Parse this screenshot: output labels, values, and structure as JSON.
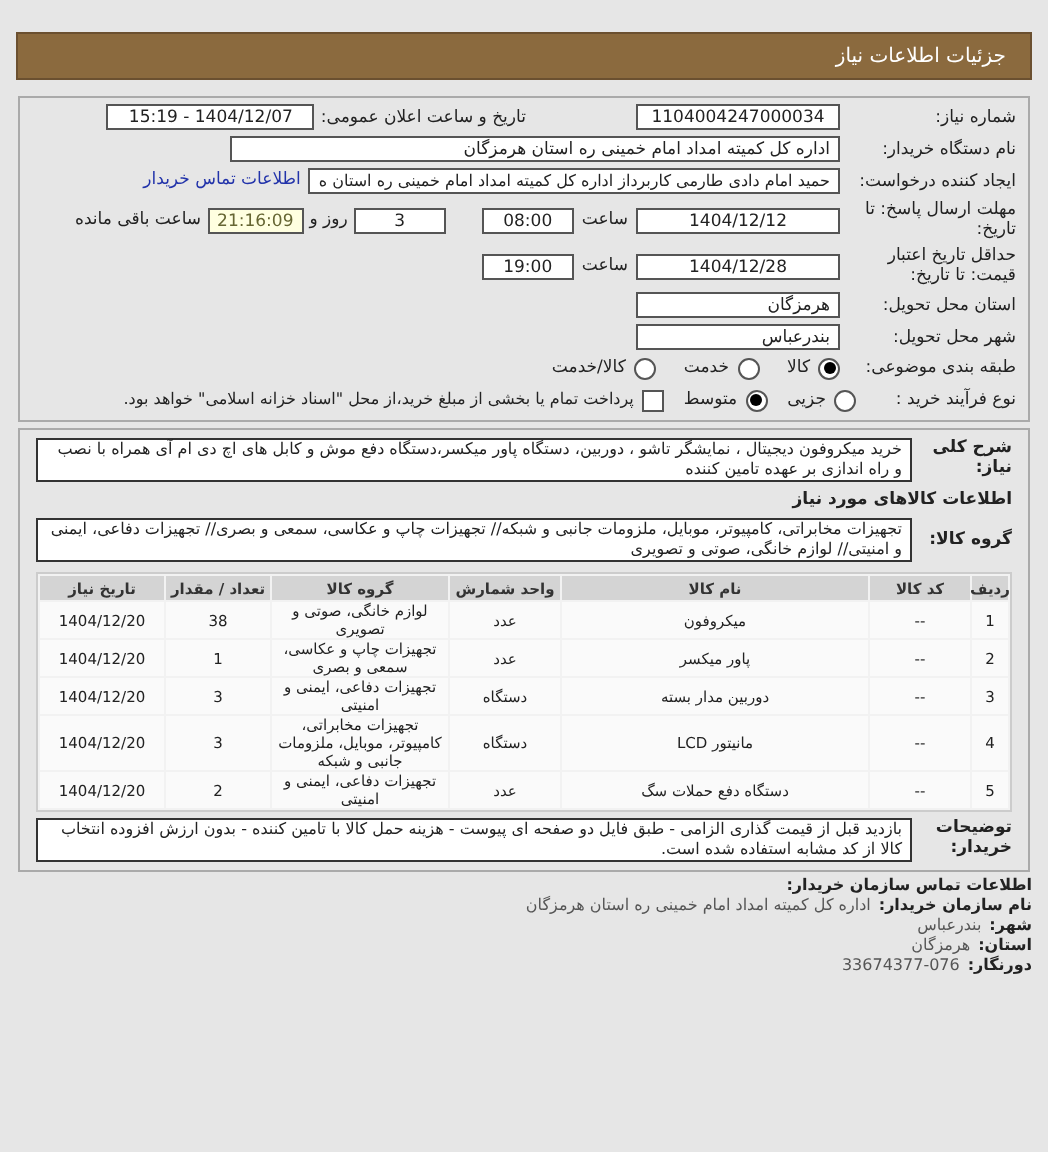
{
  "header": {
    "title": "جزئیات اطلاعات نیاز"
  },
  "need_number": {
    "label": "شماره نیاز:",
    "value": "1104004247000034"
  },
  "announce": {
    "label": "تاریخ و ساعت اعلان عمومی:",
    "value": "1404/12/07 - 15:19"
  },
  "buyer_org": {
    "label": "نام دستگاه خریدار:",
    "value": "اداره کل کمیته امداد امام خمینی  ره  استان هرمزگان"
  },
  "creator": {
    "label": "ایجاد کننده درخواست:",
    "value": "حمید امام دادی طارمی کاربرداز اداره کل کمیته امداد امام خمینی  ره  استان ه",
    "link": "اطلاعات تماس خریدار"
  },
  "deadline": {
    "label": "مهلت ارسال پاسخ: تا تاریخ:",
    "date": "1404/12/12",
    "time_label": "ساعت",
    "time": "08:00",
    "days": "3",
    "days_label": "روز و",
    "remaining": "21:16:09",
    "remaining_label": "ساعت باقی مانده"
  },
  "validity": {
    "label": "حداقل تاریخ اعتبار قیمت: تا تاریخ:",
    "date": "1404/12/28",
    "time_label": "ساعت",
    "time": "19:00"
  },
  "province": {
    "label": "استان محل تحویل:",
    "value": "هرمزگان"
  },
  "city": {
    "label": "شهر محل تحویل:",
    "value": "بندرعباس"
  },
  "category": {
    "label": "طبقه بندی موضوعی:",
    "options": [
      {
        "label": "کالا",
        "selected": true
      },
      {
        "label": "خدمت",
        "selected": false
      },
      {
        "label": "کالا/خدمت",
        "selected": false
      }
    ]
  },
  "process": {
    "label": "نوع فرآیند خرید :",
    "options": [
      {
        "label": "جزیی",
        "selected": false
      },
      {
        "label": "متوسط",
        "selected": true
      }
    ],
    "payment": {
      "checked": false,
      "label": "پرداخت تمام یا بخشی از مبلغ خرید،از محل \"اسناد خزانه اسلامی\" خواهد بود."
    }
  },
  "description": {
    "label": "شرح کلی نیاز:",
    "value": "خرید میکروفون دیجیتال ، نمایشگر تاشو ، دوربین، دستگاه پاور میکسر،دستگاه دفع موش و کابل های اچ دی ام آی همراه با نصب و راه اندازی بر عهده تامین کننده"
  },
  "goods_heading": "اطلاعات کالاهای مورد نیاز",
  "goods_group": {
    "label": "گروه کالا:",
    "value": "تجهیزات مخابراتی، کامپیوتر، موبایل، ملزومات جانبی و شبکه// تجهیزات چاپ و عکاسی، سمعی و بصری// تجهیزات دفاعی، ایمنی و امنیتی// لوازم خانگی، صوتی و تصویری"
  },
  "table": {
    "columns": [
      "ردیف",
      "کد کالا",
      "نام کالا",
      "واحد شمارش",
      "گروه کالا",
      "تعداد / مقدار",
      "تاریخ نیاز"
    ],
    "rows": [
      [
        "1",
        "--",
        "میکروفون",
        "عدد",
        "لوازم خانگی، صوتی و تصویری",
        "38",
        "1404/12/20"
      ],
      [
        "2",
        "--",
        "پاور میکسر",
        "عدد",
        "تجهیزات چاپ و عکاسی، سمعی و بصری",
        "1",
        "1404/12/20"
      ],
      [
        "3",
        "--",
        "دوربین مدار بسته",
        "دستگاه",
        "تجهیزات دفاعی، ایمنی و امنیتی",
        "3",
        "1404/12/20"
      ],
      [
        "4",
        "--",
        "مانیتور LCD",
        "دستگاه",
        "تجهیزات مخابراتی، کامپیوتر، موبایل، ملزومات جانبی و شبکه",
        "3",
        "1404/12/20"
      ],
      [
        "5",
        "--",
        "دستگاه دفع حملات سگ",
        "عدد",
        "تجهیزات دفاعی، ایمنی و امنیتی",
        "2",
        "1404/12/20"
      ]
    ]
  },
  "notes": {
    "label": "توضیحات خریدار:",
    "value": "بازدید قبل از قیمت گذاری الزامی - طبق فایل دو صفحه ای پیوست - هزینه حمل کالا با تامین کننده - بدون ارزش افزوده انتخاب کالا از کد مشابه استفاده شده است."
  },
  "contact": {
    "title": "اطلاعات تماس سازمان خریدار:",
    "lines": [
      {
        "label": "نام سازمان خریدار:",
        "value": "اداره کل کمیته امداد امام خمینی ره استان هرمزگان"
      },
      {
        "label": "شهر:",
        "value": "بندرعباس"
      },
      {
        "label": "استان:",
        "value": "هرمزگان"
      },
      {
        "label": "دورنگار:",
        "value": "33674377-076"
      }
    ]
  }
}
